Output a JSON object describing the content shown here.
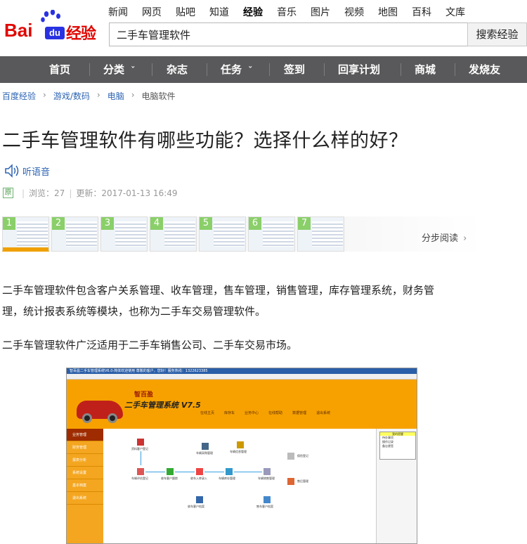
{
  "header": {
    "logo_text": "Bai",
    "logo_du": "du",
    "logo_suffix": "经验",
    "nav_links": [
      "新闻",
      "网页",
      "贴吧",
      "知道",
      "经验",
      "音乐",
      "图片",
      "视频",
      "地图",
      "百科",
      "文库"
    ],
    "active_nav": "经验",
    "search_value": "二手车管理软件",
    "search_button": "搜索经验"
  },
  "menu": {
    "items": [
      "首页",
      "分类",
      "杂志",
      "任务",
      "签到",
      "回享计划",
      "商城",
      "发烧友"
    ],
    "dropdown_marker": "ˇ"
  },
  "breadcrumb": [
    "百度经验",
    "游戏/数码",
    "电脑",
    "电脑软件"
  ],
  "article": {
    "title": "二手车管理软件有哪些功能？选择什么样的好？",
    "listen_label": "听语音",
    "original_badge": "原",
    "views_label": "浏览：27",
    "updated_label": "更新：2017-01-13 16:49",
    "steps": [
      "1",
      "2",
      "3",
      "4",
      "5",
      "6",
      "7"
    ],
    "step_read_label": "分步阅读",
    "paragraph1_line1": "二手车管理软件包含客户关系管理、收车管理，售车管理，销售管理，库存管理系统，财务管",
    "paragraph1_line2": "理，统计报表系统等模块，也称为二手车交易管理软件。",
    "paragraph2": "二手车管理软件广泛适用于二手车销售公司、二手车交易市场。"
  },
  "screenshot": {
    "window_title": "智百盈二手车管理系统V6.0-简体欢迎使用   尊敬的客户，您好！服务热线：1322623385",
    "brand": "智百盈",
    "app_name": "二手车管理系统 V7.5",
    "toolbar": [
      "在线主页",
      "库存车",
      "业务中心",
      "在线帮助",
      "数据管理",
      "退出系统"
    ],
    "sidebar": [
      "业务管理",
      "财务管理",
      "报表分析",
      "系统设置",
      "基本档案",
      "退出系统"
    ],
    "flow_labels": [
      "资料客户登记",
      "车辆评估登记",
      "收车客户跟踪",
      "收车入库录入",
      "收车客户档案",
      "车辆采购管理",
      "车辆信息管理",
      "车辆库存管理",
      "车辆销售管理",
      "售车客户档案",
      "保险登记",
      "售后管理"
    ],
    "right_panel": [
      "我的提醒",
      "待办事项",
      "操作记录",
      "备忘便签"
    ]
  }
}
